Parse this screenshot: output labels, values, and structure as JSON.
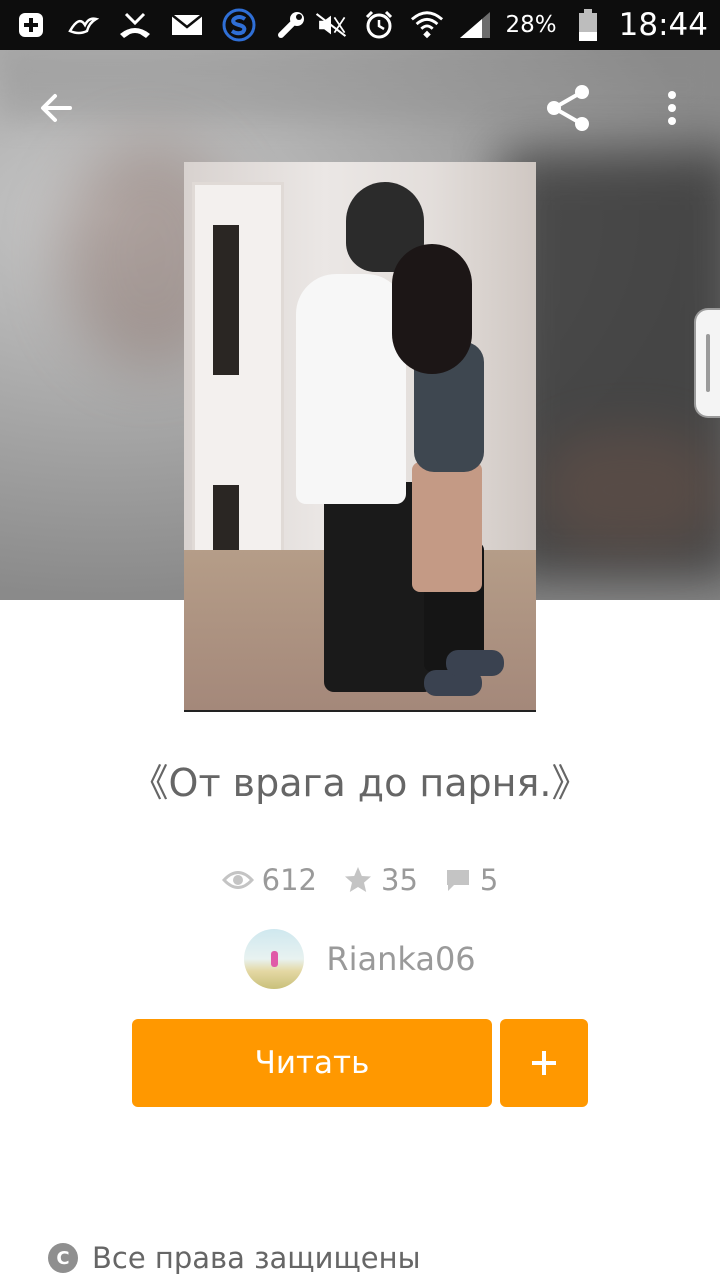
{
  "status_bar": {
    "battery_percent": "28%",
    "time": "18:44",
    "icons_left": [
      "add-box-icon",
      "bird-icon",
      "missed-call-icon",
      "mail-icon",
      "s-app-icon",
      "wrench-icon"
    ],
    "icons_right": [
      "mute-icon",
      "alarm-icon",
      "wifi-icon",
      "signal-icon",
      "battery-icon"
    ]
  },
  "toolbar": {
    "back_icon": "arrow-left-icon",
    "share_icon": "share-icon",
    "menu_icon": "more-vertical-icon"
  },
  "book": {
    "title": "《От врага до парня.》",
    "views": "612",
    "stars": "35",
    "comments": "5",
    "author": "Rianka06"
  },
  "actions": {
    "read_label": "Читать",
    "add_label": "+"
  },
  "footer": {
    "copyright_text": "Все права защищены"
  },
  "colors": {
    "accent": "#ff9800",
    "status_bar": "#0d0d0d",
    "text_primary": "#666666",
    "text_secondary": "#9a9a9a"
  }
}
